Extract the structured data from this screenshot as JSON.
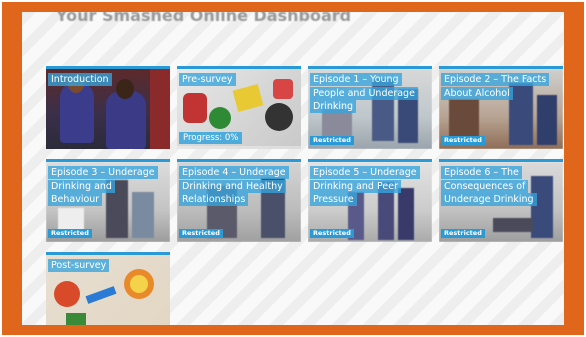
{
  "dashboard": {
    "title": "Your Smashed Online Dashboard"
  },
  "cards": [
    {
      "id": "introduction",
      "title": "Introduction"
    },
    {
      "id": "pre-survey",
      "title": "Pre-survey",
      "progress_label": "Progress: 0%",
      "progress": 0
    },
    {
      "id": "episode-1",
      "title": "Episode 1 – Young People and Underage Drinking",
      "badge": "Restricted"
    },
    {
      "id": "episode-2",
      "title": "Episode 2 – The Facts About Alcohol",
      "badge": "Restricted"
    },
    {
      "id": "episode-3",
      "title": "Episode 3 – Underage Drinking and Behaviour",
      "badge": "Restricted"
    },
    {
      "id": "episode-4",
      "title": "Episode 4 – Underage Drinking and Healthy Relationships",
      "badge": "Restricted"
    },
    {
      "id": "episode-5",
      "title": "Episode 5 – Underage Drinking and Peer Pressure",
      "badge": "Restricted"
    },
    {
      "id": "episode-6",
      "title": "Episode 6 – The Consequences of Underage Drinking",
      "badge": "Restricted"
    },
    {
      "id": "post-survey",
      "title": "Post-survey"
    }
  ],
  "colors": {
    "frame": "#e0661c",
    "accent": "#2a9ad6"
  }
}
